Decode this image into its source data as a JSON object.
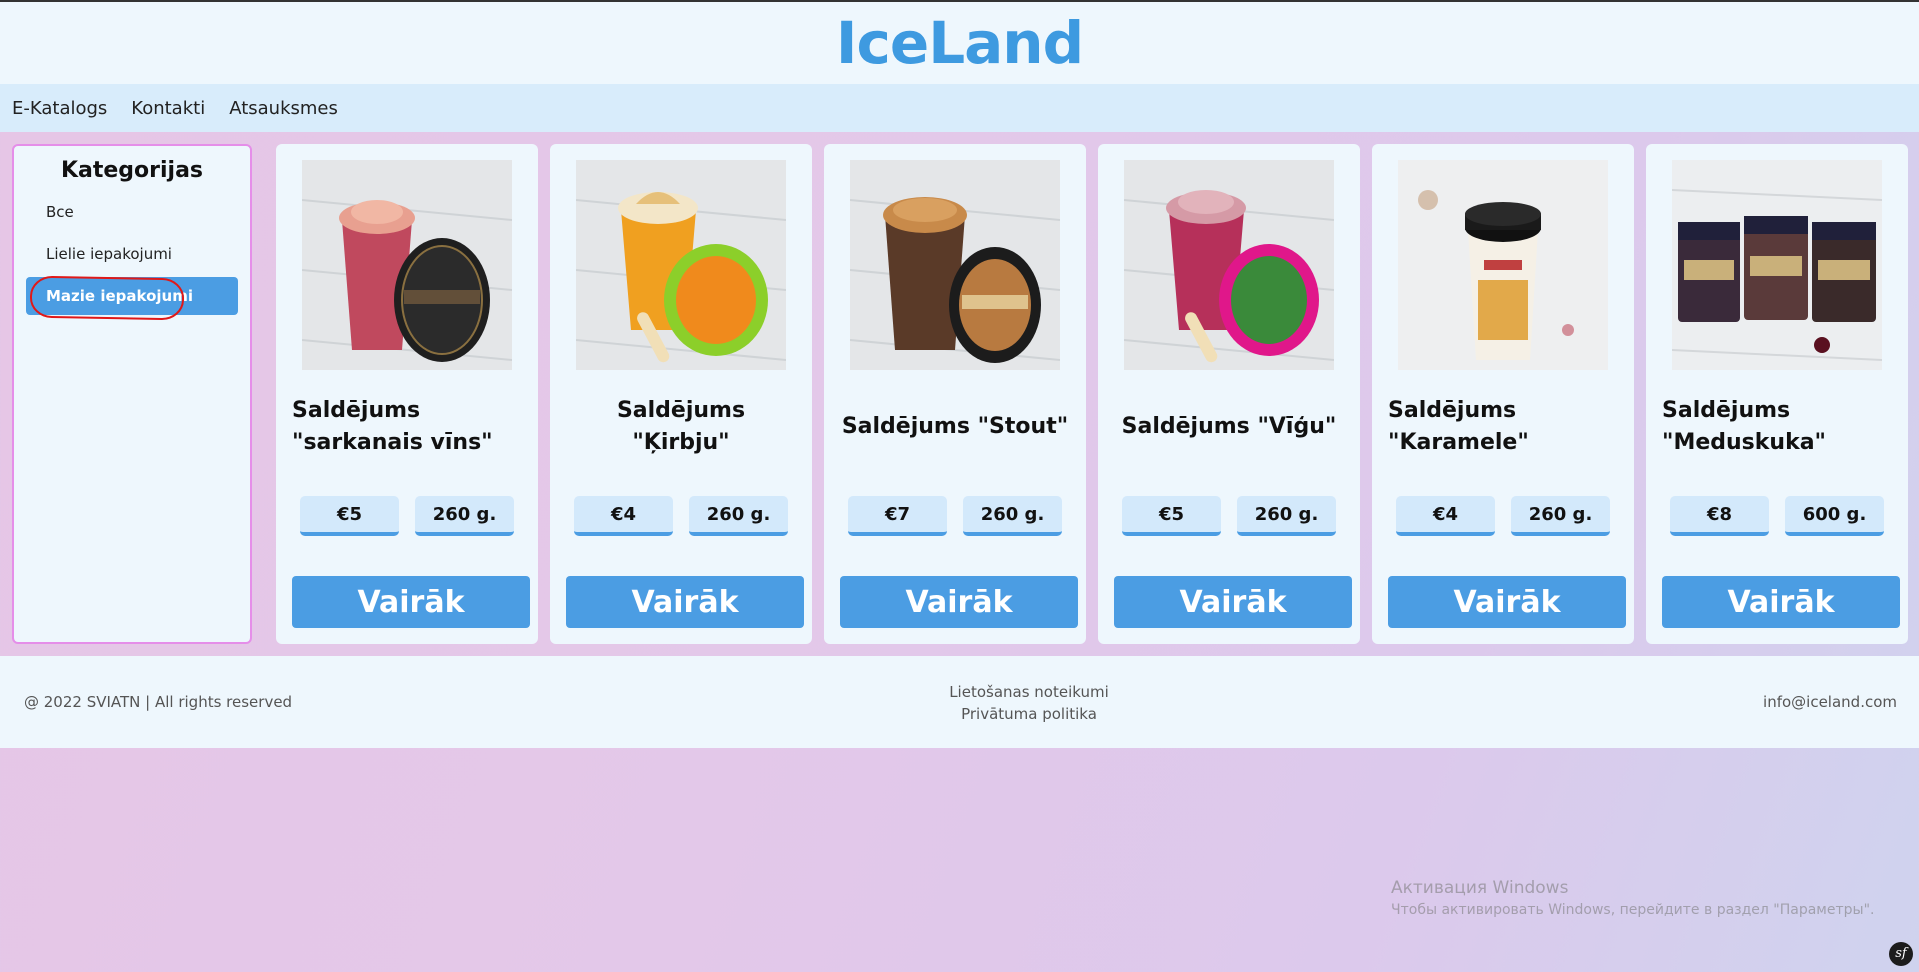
{
  "brand": {
    "title": "IceLand"
  },
  "nav": {
    "items": [
      "E-Katalogs",
      "Kontakti",
      "Atsauksmes"
    ]
  },
  "sidebar": {
    "title": "Kategorijas",
    "items": [
      {
        "label": "Все",
        "active": false
      },
      {
        "label": "Lielie iepakojumi",
        "active": false
      },
      {
        "label": "Mazie iepakojumi",
        "active": true
      }
    ]
  },
  "products": [
    {
      "name": "Saldējums \"sarkanais vīns\"",
      "price": "€5",
      "weight": "260 g.",
      "button": "Vairāk",
      "image": "ice-cream-red-wine-cup"
    },
    {
      "name": "Saldējums \"Ķirbju\"",
      "price": "€4",
      "weight": "260 g.",
      "button": "Vairāk",
      "image": "ice-cream-pumpkin-cup"
    },
    {
      "name": "Saldējums \"Stout\"",
      "price": "€7",
      "weight": "260 g.",
      "button": "Vairāk",
      "image": "ice-cream-stout-cup"
    },
    {
      "name": "Saldējums \"Vīģu\"",
      "price": "€5",
      "weight": "260 g.",
      "button": "Vairāk",
      "image": "ice-cream-fig-cup"
    },
    {
      "name": "Saldējums \"Karamele\"",
      "price": "€4",
      "weight": "260 g.",
      "button": "Vairāk",
      "image": "ice-cream-caramel-tub"
    },
    {
      "name": "Saldējums \"Meduskuka\"",
      "price": "€8",
      "weight": "600 g.",
      "button": "Vairāk",
      "image": "ice-cream-honey-cake-boxes"
    }
  ],
  "footer": {
    "copyright": "@ 2022 SVIATN | All rights reserved",
    "links": [
      "Lietošanas noteikumi",
      "Privātuma politika"
    ],
    "email": "info@iceland.com"
  },
  "watermark": {
    "title": "Активация Windows",
    "subtitle": "Чтобы активировать Windows, перейдите в раздел \"Параметры\"."
  },
  "badge": {
    "label": "sf"
  },
  "colors": {
    "accent": "#4b9de3",
    "brand": "#3e9ae0",
    "highlight_annotation": "#e01818"
  }
}
